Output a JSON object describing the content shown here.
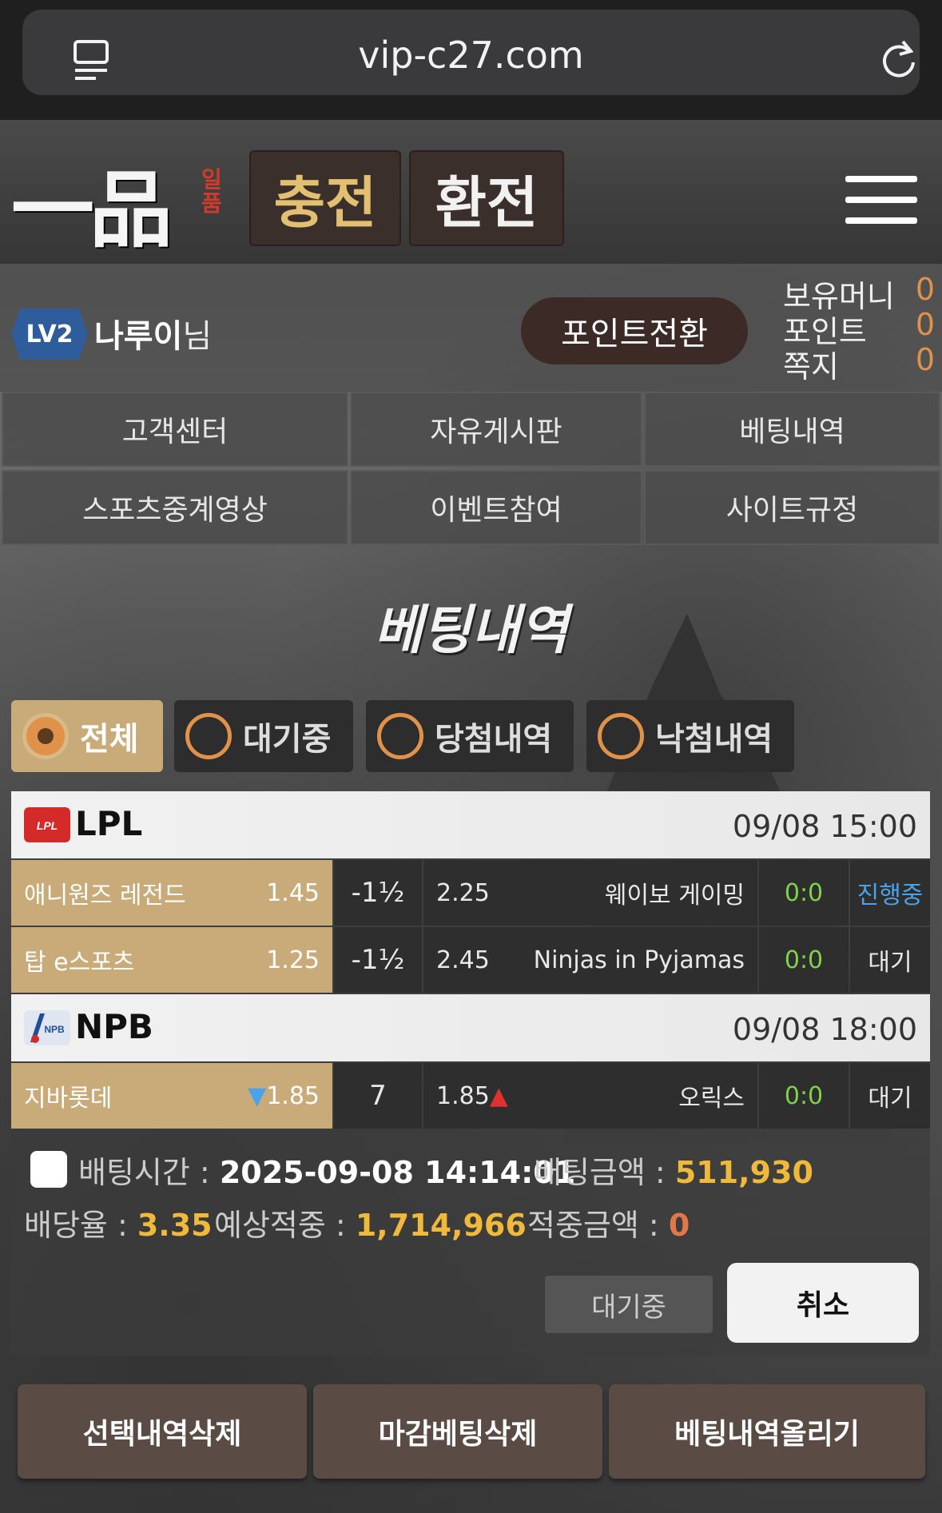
{
  "browser": {
    "url": "vip-c27.com"
  },
  "header": {
    "logo_text": "一品",
    "logo_sub": "일품",
    "charge_label": "충전",
    "exchange_label": "환전"
  },
  "user": {
    "level": "LV2",
    "name": "나루이",
    "suffix": "님",
    "point_convert_label": "포인트전환",
    "stats": [
      {
        "label": "보유머니",
        "value": "0"
      },
      {
        "label": "포인트",
        "value": "0"
      },
      {
        "label": "쪽지",
        "value": "0"
      }
    ]
  },
  "nav": [
    "고객센터",
    "자유게시판",
    "베팅내역",
    "스포츠중계영상",
    "이벤트참여",
    "사이트규정"
  ],
  "page_title": "베팅내역",
  "filters": [
    {
      "label": "전체",
      "active": true
    },
    {
      "label": "대기중",
      "active": false
    },
    {
      "label": "당첨내역",
      "active": false
    },
    {
      "label": "낙첨내역",
      "active": false
    }
  ],
  "bet": {
    "groups": [
      {
        "league": "LPL",
        "time": "09/08 15:00",
        "matches": [
          {
            "home": "애니원즈 레전드",
            "home_odds": "1.45",
            "handicap": "-1½",
            "away_odds": "2.25",
            "away": "웨이보 게이밍",
            "score": "0:0",
            "status": "진행중"
          },
          {
            "home": "탑 e스포츠",
            "home_odds": "1.25",
            "handicap": "-1½",
            "away_odds": "2.45",
            "away": "Ninjas in Pyjamas",
            "score": "0:0",
            "status": "대기"
          }
        ]
      },
      {
        "league": "NPB",
        "time": "09/08 18:00",
        "matches": [
          {
            "home": "지바롯데",
            "home_odds": "1.85",
            "handicap": "7",
            "away_odds": "1.85",
            "away": "오릭스",
            "score": "0:0",
            "status": "대기"
          }
        ]
      }
    ],
    "bet_time_label": "배팅시간 :",
    "bet_time": "2025-09-08 14:14:01",
    "bet_amount_label": "배팅금액 :",
    "bet_amount": "511,930",
    "odds_label": "배당율 :",
    "odds": "3.35",
    "expected_label": "예상적중 :",
    "expected": "1,714,966",
    "win_label": "적중금액 :",
    "win": "0",
    "status_label": "대기중",
    "cancel_label": "취소"
  },
  "bottom_buttons": [
    "선택내역삭제",
    "마감베팅삭제",
    "베팅내역올리기"
  ],
  "colors": {
    "accent_gold": "#c8ab78",
    "accent_orange": "#e0924a",
    "live_blue": "#4aa3e8",
    "score_green": "#7fd34a"
  }
}
